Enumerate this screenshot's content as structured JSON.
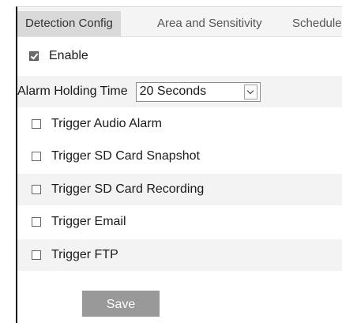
{
  "tabs": [
    {
      "label": "Detection Config",
      "active": true
    },
    {
      "label": "Area and Sensitivity",
      "active": false
    },
    {
      "label": "Schedule",
      "active": false
    }
  ],
  "enable": {
    "label": "Enable",
    "checked": true
  },
  "alarm_holding": {
    "label": "Alarm Holding Time",
    "selected": "20 Seconds"
  },
  "triggers": [
    {
      "label": "Trigger Audio Alarm",
      "checked": false
    },
    {
      "label": "Trigger SD Card Snapshot",
      "checked": false
    },
    {
      "label": "Trigger SD Card Recording",
      "checked": false
    },
    {
      "label": "Trigger Email",
      "checked": false
    },
    {
      "label": "Trigger FTP",
      "checked": false
    }
  ],
  "save_label": "Save",
  "colors": {
    "active_tab_bg": "#d9d9d9",
    "tabbar_bg": "#f4f4f4",
    "row_shade": "#f3f3f3",
    "button_bg": "#999999",
    "left_border": "#111111"
  }
}
